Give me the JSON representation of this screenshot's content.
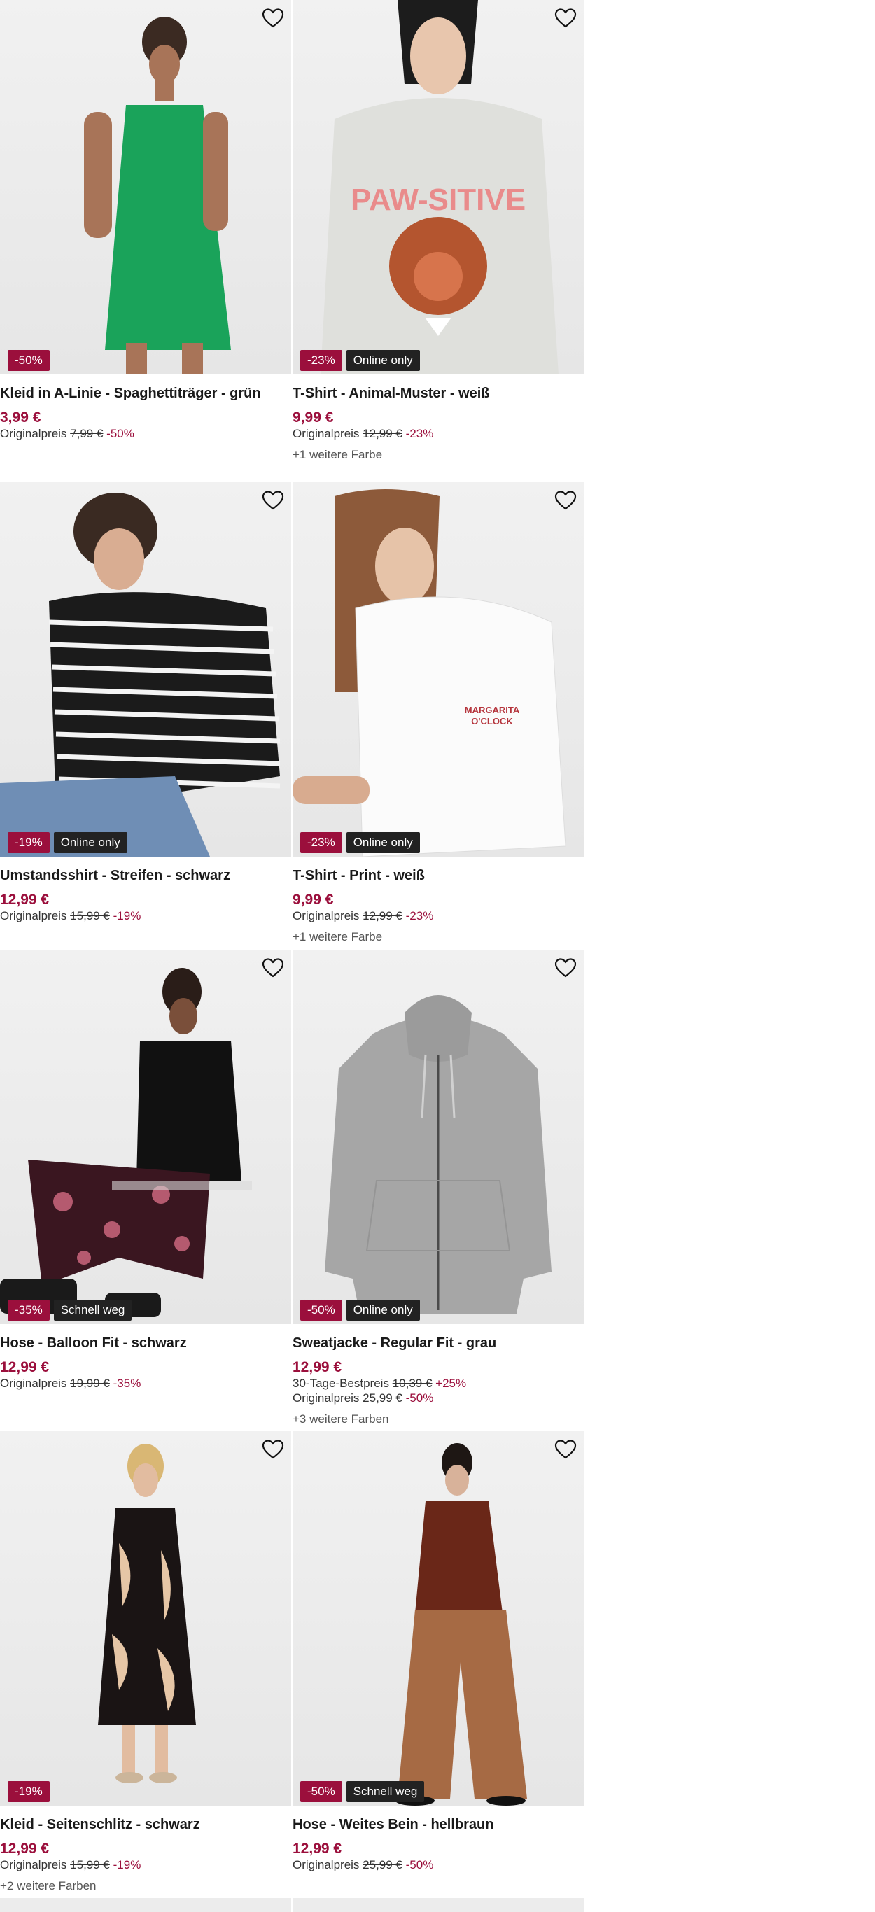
{
  "products": [
    {
      "title": "Kleid in A-Linie - Spaghettiträger - grün",
      "price": "3,99 €",
      "discount_badge": "-50%",
      "tag": "",
      "original_label": "Originalpreis",
      "original_price": "7,99 €",
      "original_pct": "-50%",
      "best_label": "",
      "best_price": "",
      "best_pct": "",
      "more_colors": "",
      "wishlist_icon": "heart-outline-icon"
    },
    {
      "title": "T-Shirt - Animal-Muster - weiß",
      "price": "9,99 €",
      "discount_badge": "-23%",
      "tag": "Online only",
      "original_label": "Originalpreis",
      "original_price": "12,99 €",
      "original_pct": "-23%",
      "best_label": "",
      "best_price": "",
      "best_pct": "",
      "more_colors": "+1 weitere Farbe",
      "wishlist_icon": "heart-outline-icon"
    },
    {
      "title": "Umstandsshirt - Streifen - schwarz",
      "price": "12,99 €",
      "discount_badge": "-19%",
      "tag": "Online only",
      "original_label": "Originalpreis",
      "original_price": "15,99 €",
      "original_pct": "-19%",
      "best_label": "",
      "best_price": "",
      "best_pct": "",
      "more_colors": "",
      "wishlist_icon": "heart-outline-icon"
    },
    {
      "title": "T-Shirt - Print - weiß",
      "price": "9,99 €",
      "discount_badge": "-23%",
      "tag": "Online only",
      "original_label": "Originalpreis",
      "original_price": "12,99 €",
      "original_pct": "-23%",
      "best_label": "",
      "best_price": "",
      "best_pct": "",
      "more_colors": "+1 weitere Farbe",
      "wishlist_icon": "heart-outline-icon"
    },
    {
      "title": "Hose - Balloon Fit - schwarz",
      "price": "12,99 €",
      "discount_badge": "-35%",
      "tag": "Schnell weg",
      "original_label": "Originalpreis",
      "original_price": "19,99 €",
      "original_pct": "-35%",
      "best_label": "",
      "best_price": "",
      "best_pct": "",
      "more_colors": "",
      "wishlist_icon": "heart-outline-icon"
    },
    {
      "title": "Sweatjacke - Regular Fit - grau",
      "price": "12,99 €",
      "discount_badge": "-50%",
      "tag": "Online only",
      "original_label": "Originalpreis",
      "original_price": "25,99 €",
      "original_pct": "-50%",
      "best_label": "30-Tage-Bestpreis",
      "best_price": "10,39 €",
      "best_pct": "+25%",
      "more_colors": "+3 weitere Farben",
      "wishlist_icon": "heart-outline-icon"
    },
    {
      "title": "Kleid - Seitenschlitz - schwarz",
      "price": "12,99 €",
      "discount_badge": "-19%",
      "tag": "",
      "original_label": "Originalpreis",
      "original_price": "15,99 €",
      "original_pct": "-19%",
      "best_label": "",
      "best_price": "",
      "best_pct": "",
      "more_colors": "+2 weitere Farben",
      "wishlist_icon": "heart-outline-icon"
    },
    {
      "title": "Hose - Weites Bein - hellbraun",
      "price": "12,99 €",
      "discount_badge": "-50%",
      "tag": "Schnell weg",
      "original_label": "Originalpreis",
      "original_price": "25,99 €",
      "original_pct": "-50%",
      "best_label": "",
      "best_price": "",
      "best_pct": "",
      "more_colors": "",
      "wishlist_icon": "heart-outline-icon"
    }
  ],
  "colors": {
    "accent": "#9b0f3c",
    "tag_bg": "#222222",
    "image_bg": "#ececec"
  }
}
